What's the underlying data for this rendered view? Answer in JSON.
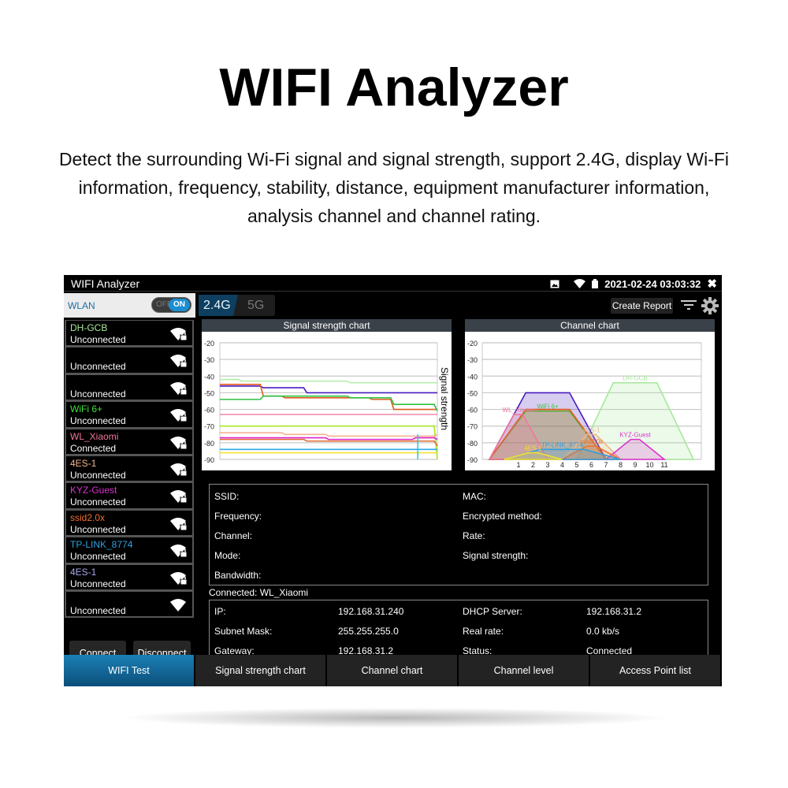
{
  "header": {
    "title": "WIFI Analyzer",
    "description": "Detect the surrounding Wi-Fi signal and signal strength, support 2.4G, display Wi-Fi information, frequency, stability, distance, equipment manufacturer information, analysis channel and channel rating."
  },
  "status_bar": {
    "app_title": "WIFI Analyzer",
    "datetime": "2021-02-24 03:03:32",
    "icons": [
      "image-icon",
      "wifi-icon",
      "battery-icon",
      "close-icon"
    ]
  },
  "wlan": {
    "label": "WLAN",
    "toggle_off": "OFF",
    "toggle_on": "ON",
    "state": "on"
  },
  "networks": [
    {
      "ssid": "DH-GCB",
      "status": "Unconnected",
      "color": "#a6e89a",
      "locked": true
    },
    {
      "ssid": "",
      "status": "Unconnected",
      "color": "#ffffff",
      "locked": true
    },
    {
      "ssid": "",
      "status": "Unconnected",
      "color": "#ffffff",
      "locked": true
    },
    {
      "ssid": "WiFi 6+",
      "status": "Unconnected",
      "color": "#3fe03f",
      "locked": true
    },
    {
      "ssid": "WL_Xiaomi",
      "status": "Connected",
      "color": "#f07898",
      "locked": true
    },
    {
      "ssid": "4ES-1",
      "status": "Unconnected",
      "color": "#f0b488",
      "locked": true
    },
    {
      "ssid": "KYZ-Guest",
      "status": "Unconnected",
      "color": "#e030d0",
      "locked": true
    },
    {
      "ssid": "ssid2.0x",
      "status": "Unconnected",
      "color": "#f07030",
      "locked": true
    },
    {
      "ssid": "TP-LINK_8774",
      "status": "Unconnected",
      "color": "#2ea0e0",
      "locked": true
    },
    {
      "ssid": "4ES-1",
      "status": "Unconnected",
      "color": "#a8a8f0",
      "locked": true
    },
    {
      "ssid": "",
      "status": "Unconnected",
      "color": "#ffffff",
      "locked": false
    }
  ],
  "buttons": {
    "connect": "Connect",
    "disconnect": "Disconnect",
    "create_report": "Create Report"
  },
  "bands": {
    "tab_24": "2.4G",
    "tab_5": "5G",
    "active": "2.4G"
  },
  "chart_data": [
    {
      "type": "line",
      "title": "Signal strength chart",
      "ylabel": "Signal strength",
      "ylim": [
        -90,
        -20
      ],
      "yticks": [
        -20,
        -30,
        -40,
        -50,
        -60,
        -70,
        -80,
        -90
      ],
      "grid": true,
      "x": [
        0,
        1,
        2,
        3,
        4,
        5,
        6,
        7,
        8,
        9,
        10
      ],
      "series": [
        {
          "color": "#b4eea8",
          "values": [
            -42,
            -43,
            -43,
            -43,
            -43,
            -43,
            -44,
            -44,
            -44,
            -44,
            -44
          ]
        },
        {
          "color": "#4a1cc0",
          "values": [
            -46,
            -46,
            -47,
            -47,
            -50,
            -50,
            -50,
            -50,
            -50,
            -50,
            -50
          ]
        },
        {
          "color": "#e05a20",
          "values": [
            -45,
            -45,
            -52,
            -53,
            -53,
            -53,
            -53,
            -54,
            -60,
            -60,
            -60
          ]
        },
        {
          "color": "#2ec040",
          "values": [
            -54,
            -54,
            -52,
            -52,
            -52,
            -52,
            -53,
            -53,
            -57,
            -57,
            -61
          ]
        },
        {
          "color": "#f090b0",
          "values": [
            -63,
            -63,
            -63,
            -63,
            -63,
            -63,
            -63,
            -63,
            -63,
            -63,
            -63
          ]
        },
        {
          "color": "#a8e820",
          "values": [
            -70,
            -70,
            -70,
            -70,
            -70,
            -70,
            -70,
            -70,
            -70,
            -70,
            -90
          ]
        },
        {
          "color": "#f4b090",
          "values": [
            -74,
            -74,
            -74,
            -75,
            -75,
            -76,
            -76,
            -76,
            -76,
            -76,
            -75
          ]
        },
        {
          "color": "#e020c8",
          "values": [
            -77,
            -77,
            -77,
            -77,
            -77,
            -78,
            -78,
            -78,
            -78,
            -77,
            -78
          ]
        },
        {
          "color": "#e06a30",
          "values": [
            -78,
            -78,
            -78,
            -78,
            -79,
            -79,
            -79,
            -79,
            -79,
            -79,
            -82
          ]
        },
        {
          "color": "#2aa8e8",
          "values": [
            -84,
            -84,
            -84,
            -84,
            -84,
            -84,
            -84,
            -84,
            -84,
            -84,
            -84
          ]
        },
        {
          "color": "#f4e030",
          "values": [
            -86,
            -86,
            -86,
            -86,
            -86,
            -86,
            -86,
            -86,
            -86,
            -86,
            -86
          ]
        }
      ]
    },
    {
      "type": "area",
      "title": "Channel chart",
      "ylim": [
        -90,
        -20
      ],
      "yticks": [
        -20,
        -30,
        -40,
        -50,
        -60,
        -70,
        -80,
        -90
      ],
      "xticks": [
        1,
        2,
        3,
        4,
        5,
        6,
        7,
        8,
        9,
        10,
        11
      ],
      "grid": true,
      "series": [
        {
          "name": "DH-GCB",
          "channel": 9,
          "level": -44,
          "span": 4,
          "color": "#a6e89a"
        },
        {
          "name": "",
          "channel": 3,
          "level": -50,
          "span": 4,
          "color": "#4a1cc0"
        },
        {
          "name": "WiFi 6+",
          "channel": 3,
          "level": -61,
          "span": 4,
          "color": "#3fc040"
        },
        {
          "name": "",
          "channel": 3,
          "level": -60,
          "span": 4,
          "color": "#e05a20"
        },
        {
          "name": "WL_Xiaomi",
          "channel": 1,
          "level": -63,
          "span": 2,
          "color": "#f07898"
        },
        {
          "name": "4ES-1",
          "channel": 6,
          "level": -75,
          "span": 2,
          "color": "#f0b488"
        },
        {
          "name": "KYZ-Guest",
          "channel": 9,
          "level": -78,
          "span": 2,
          "color": "#e030d0"
        },
        {
          "name": "ssid2.0x",
          "channel": 6,
          "level": -82,
          "span": 2,
          "color": "#f07030"
        },
        {
          "name": "TP-LINK_8774",
          "channel": 4,
          "level": -84,
          "span": 4,
          "color": "#2ea0e0"
        },
        {
          "name": "4ES-1",
          "channel": 2,
          "level": -86,
          "span": 2,
          "color": "#f4e030"
        }
      ]
    }
  ],
  "details": {
    "ssid": "SSID:",
    "frequency": "Frequency:",
    "channel": "Channel:",
    "mode": "Mode:",
    "bandwidth": "Bandwidth:",
    "mac": "MAC:",
    "encrypted": "Encrypted method:",
    "rate": "Rate:",
    "signal": "Signal strength:"
  },
  "connection": {
    "label": "Connected: WL_Xiaomi",
    "ip_label": "IP:",
    "ip": "192.168.31.240",
    "mask_label": "Subnet Mask:",
    "mask": "255.255.255.0",
    "gateway_label": "Gateway:",
    "gateway": "192.168.31.2",
    "dhcp_label": "DHCP Server:",
    "dhcp": "192.168.31.2",
    "rate_label": "Real rate:",
    "rate": "0.0 kb/s",
    "status_label": "Status:",
    "status": "Connected"
  },
  "nav": [
    {
      "label": "WIFI Test",
      "active": true
    },
    {
      "label": "Signal strength chart"
    },
    {
      "label": "Channel chart"
    },
    {
      "label": "Channel level"
    },
    {
      "label": "Access Point list"
    }
  ]
}
